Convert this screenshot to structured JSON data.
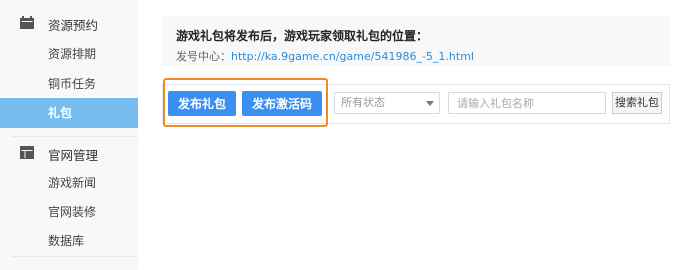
{
  "sidebar": {
    "groups": [
      {
        "title": "资源预约",
        "icon": "calendar-icon",
        "items": [
          {
            "label": "资源排期"
          },
          {
            "label": "铜币任务"
          },
          {
            "label": "礼包",
            "active": true
          }
        ]
      },
      {
        "title": "官网管理",
        "icon": "grid-icon",
        "items": [
          {
            "label": "游戏新闻"
          },
          {
            "label": "官网装修"
          },
          {
            "label": "数据库"
          }
        ]
      }
    ]
  },
  "notice": {
    "title": "游戏礼包将发布后，游戏玩家领取礼包的位置：",
    "prefix": "发号中心：",
    "link": "http://ka.9game.cn/game/541986_-5_1.html"
  },
  "toolbar": {
    "publish_gift_label": "发布礼包",
    "publish_code_label": "发布激活码",
    "status_select_value": "所有状态",
    "search_placeholder": "请输入礼包名称",
    "search_button_label": "搜索礼包"
  },
  "colors": {
    "primary": "#3b8ff0",
    "sidebar_active": "#77bcef",
    "highlight": "#f08a24",
    "link": "#2d8cd6"
  }
}
